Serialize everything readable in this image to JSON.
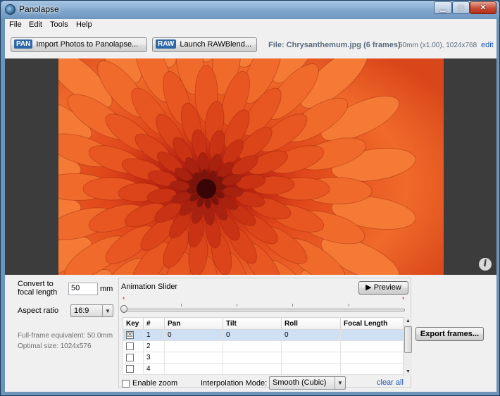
{
  "window": {
    "title": "Panolapse",
    "minimize": "▁",
    "maximize": "□",
    "close": "✕",
    "app_icon": "panolapse-icon"
  },
  "menu": [
    "File",
    "Edit",
    "Tools",
    "Help"
  ],
  "toolbar": {
    "import_tag": "PAN",
    "import_label": "Import Photos to Panolapse...",
    "raw_tag": "RAW",
    "raw_label": "Launch RAWBlend...",
    "file_info": "File: Chrysanthemum.jpg (6 frames)",
    "lens_info": "50mm (x1.00), 1024x768",
    "edit_link": "edit"
  },
  "viewer": {
    "info_icon": "i"
  },
  "settings": {
    "convert_label_1": "Convert to",
    "convert_label_2": "focal length",
    "focal_value": "50",
    "focal_unit": "mm",
    "aspect_label": "Aspect ratio",
    "aspect_value": "16:9",
    "fullframe_text": "Full-frame equivalent: 50.0mm",
    "optimal_text": "Optimal size: 1024x576"
  },
  "animation": {
    "title": "Animation Slider",
    "preview_label": "Preview",
    "preview_icon": "▶",
    "slider_position": 0,
    "columns": [
      "Key",
      "#",
      "Pan",
      "Tilt",
      "Roll",
      "Focal Length"
    ],
    "rows": [
      {
        "key": "☒",
        "n": "1",
        "pan": "0",
        "tilt": "0",
        "roll": "0",
        "focal": ""
      },
      {
        "key": "",
        "n": "2",
        "pan": "",
        "tilt": "",
        "roll": "",
        "focal": ""
      },
      {
        "key": "",
        "n": "3",
        "pan": "",
        "tilt": "",
        "roll": "",
        "focal": ""
      },
      {
        "key": "",
        "n": "4",
        "pan": "",
        "tilt": "",
        "roll": "",
        "focal": ""
      }
    ],
    "enable_zoom_label": "Enable zoom",
    "interp_label": "Interpolation Mode:",
    "interp_value": "Smooth (Cubic)",
    "clear_all": "clear all"
  },
  "export_label": "Export frames..."
}
